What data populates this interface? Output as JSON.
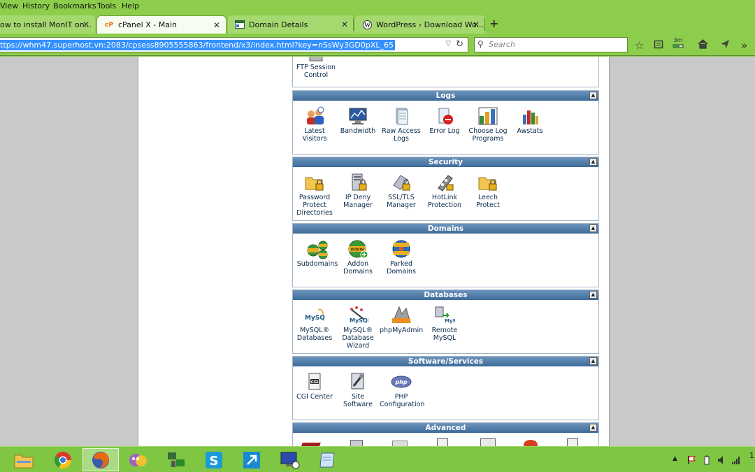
{
  "menu": [
    "View",
    "History",
    "Bookmarks",
    "Tools",
    "Help"
  ],
  "tabs": [
    {
      "title": "ow to install MonIT on...",
      "active": false
    },
    {
      "title": "cPanel X - Main",
      "active": true
    },
    {
      "title": "Domain Details",
      "active": false
    },
    {
      "title": "WordPress › Download Wo...",
      "active": false
    }
  ],
  "url": "ttps://whm47.superhost.vn:2083/cpsess8905555863/frontend/x3/index.html?key=nSsWy3GD0pXL_65",
  "search_placeholder": "Search",
  "download_badge": "3m",
  "colors": {
    "theme_green": "#8ccd4c",
    "panel_header": "#4a76a3",
    "selection": "#3390ff"
  },
  "panels": {
    "ftp_partial": {
      "items": [
        {
          "label": "FTP Session Control",
          "icon": "ftp-session-icon"
        }
      ]
    },
    "logs": {
      "title": "Logs",
      "items": [
        {
          "label": "Latest Visitors",
          "icon": "visitors-icon"
        },
        {
          "label": "Bandwidth",
          "icon": "bandwidth-icon"
        },
        {
          "label": "Raw Access Logs",
          "icon": "raw-log-icon"
        },
        {
          "label": "Error Log",
          "icon": "error-log-icon"
        },
        {
          "label": "Choose Log Programs",
          "icon": "log-programs-icon"
        },
        {
          "label": "Awstats",
          "icon": "awstats-icon"
        }
      ]
    },
    "security": {
      "title": "Security",
      "items": [
        {
          "label": "Password Protect Directories",
          "icon": "folder-lock-icon"
        },
        {
          "label": "IP Deny Manager",
          "icon": "ip-deny-icon"
        },
        {
          "label": "SSL/TLS Manager",
          "icon": "ssl-icon"
        },
        {
          "label": "HotLink Protection",
          "icon": "hotlink-icon"
        },
        {
          "label": "Leech Protect",
          "icon": "leech-icon"
        }
      ]
    },
    "domains": {
      "title": "Domains",
      "items": [
        {
          "label": "Subdomains",
          "icon": "subdomains-icon"
        },
        {
          "label": "Addon Domains",
          "icon": "addon-domains-icon"
        },
        {
          "label": "Parked Domains",
          "icon": "parked-domains-icon"
        }
      ]
    },
    "databases": {
      "title": "Databases",
      "items": [
        {
          "label": "MySQL® Databases",
          "icon": "mysql-icon"
        },
        {
          "label": "MySQL® Database Wizard",
          "icon": "mysql-wizard-icon"
        },
        {
          "label": "phpMyAdmin",
          "icon": "phpmyadmin-icon"
        },
        {
          "label": "Remote MySQL",
          "icon": "remote-mysql-icon"
        }
      ]
    },
    "software": {
      "title": "Software/Services",
      "items": [
        {
          "label": "CGI Center",
          "icon": "cgi-icon"
        },
        {
          "label": "Site Software",
          "icon": "site-software-icon"
        },
        {
          "label": "PHP Configuration",
          "icon": "php-icon"
        }
      ]
    },
    "advanced": {
      "title": "Advanced"
    }
  },
  "mysql_logo_text": "MySQL",
  "php_logo_text": "php",
  "cgi_logo_text": "CGI",
  "www_text": "www",
  "taskbar_apps": [
    "file-explorer",
    "chrome",
    "firefox",
    "messenger",
    "network-app",
    "skype",
    "remote-app",
    "remote-desktop",
    "notepad"
  ],
  "clock": "1"
}
